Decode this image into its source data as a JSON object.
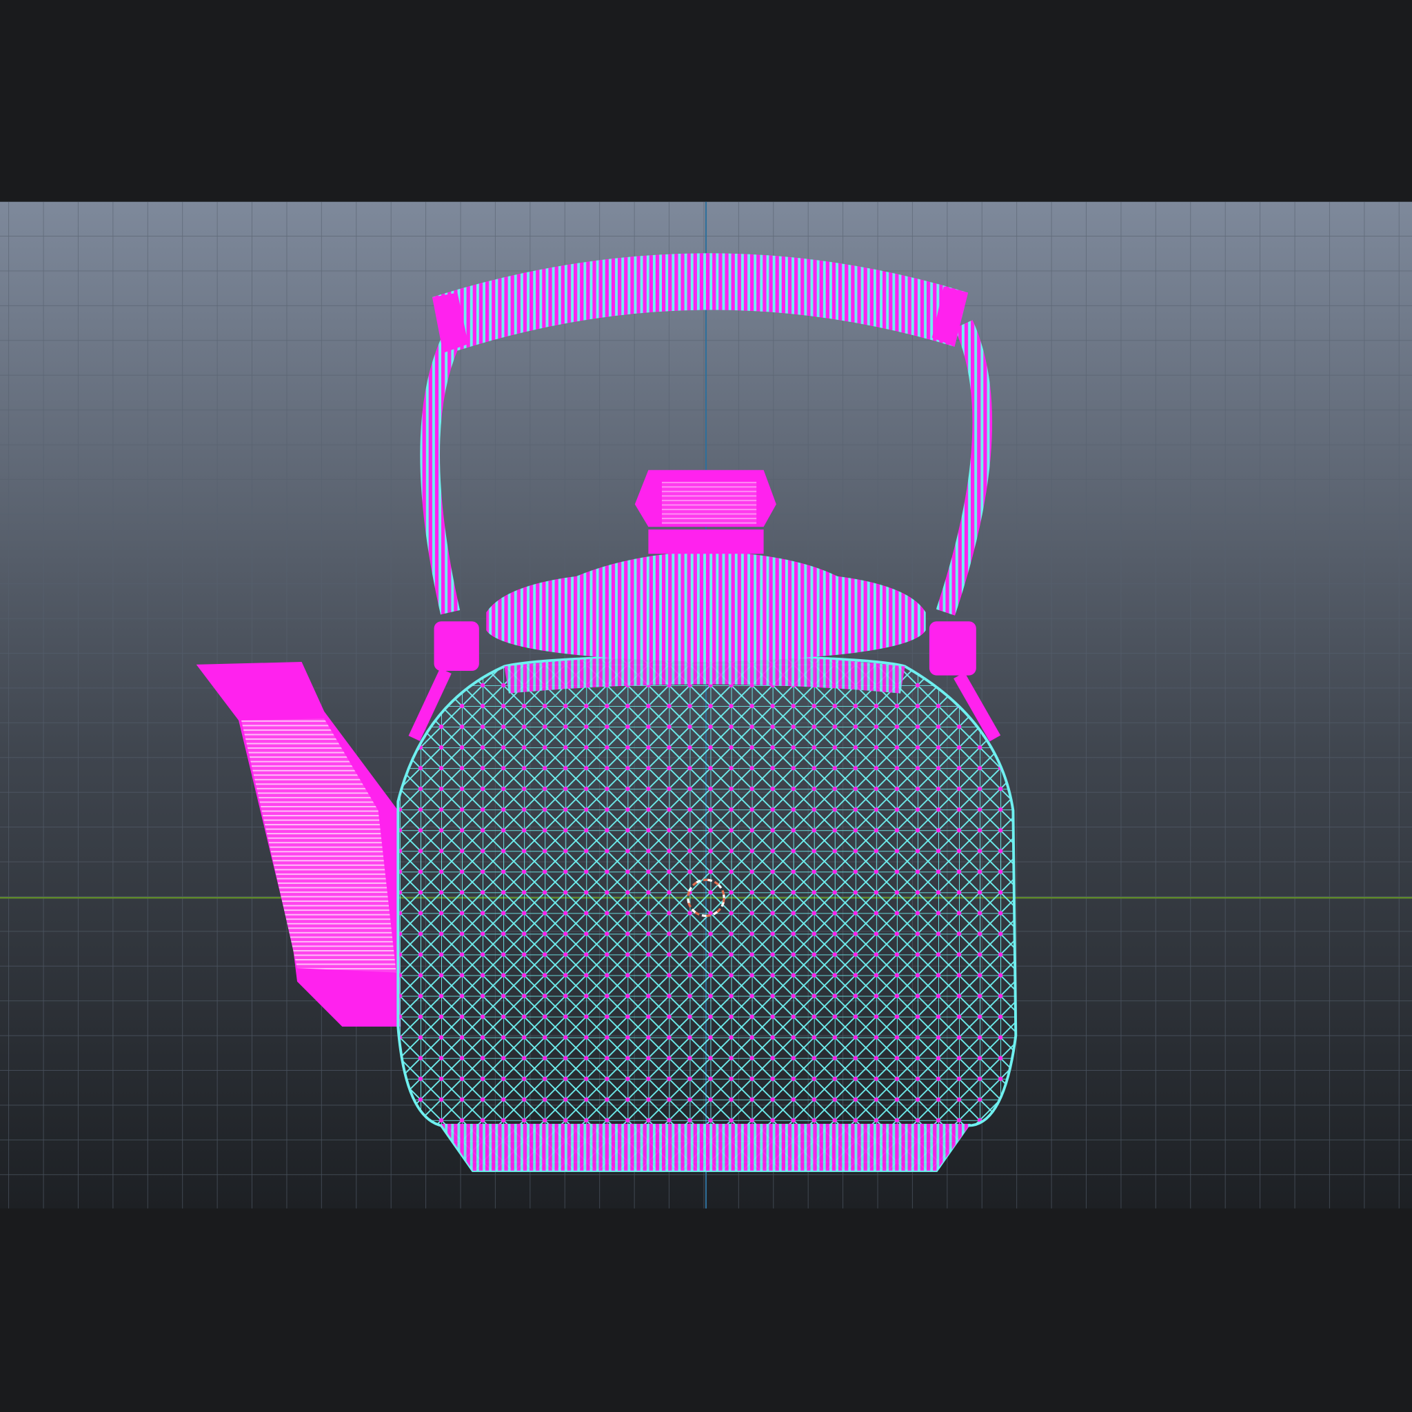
{
  "viewport": {
    "view": "front-orthographic",
    "mode": "wireframe",
    "object": "teapot"
  },
  "colors": {
    "background": "#1a1b1d",
    "grid_top": "#7d889a",
    "grid_bottom": "#1d2024",
    "grid_line": "#5e6878",
    "axis_vertical": "#2f6f9a",
    "axis_horizontal": "#5f8a2a",
    "wire_edge": "#6ff0f0",
    "wire_vertex": "#ff22ee",
    "cursor": "#e07050"
  },
  "icons": [
    "3d-cursor-icon"
  ]
}
